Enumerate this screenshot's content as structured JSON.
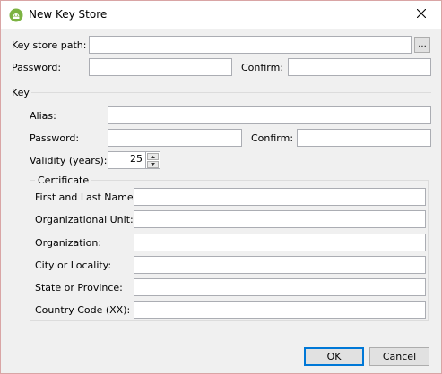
{
  "window": {
    "title": "New Key Store"
  },
  "store": {
    "path_label": "Key store path:",
    "path_value": "",
    "browse_label": "...",
    "password_label": "Password:",
    "password_value": "",
    "confirm_label": "Confirm:",
    "confirm_value": ""
  },
  "key": {
    "section_label": "Key",
    "alias_label": "Alias:",
    "alias_value": "",
    "password_label": "Password:",
    "password_value": "",
    "confirm_label": "Confirm:",
    "confirm_value": "",
    "validity_label": "Validity (years):",
    "validity_value": "25"
  },
  "certificate": {
    "legend": "Certificate",
    "fields": [
      {
        "label": "First and Last Name:",
        "value": ""
      },
      {
        "label": "Organizational Unit:",
        "value": ""
      },
      {
        "label": "Organization:",
        "value": ""
      },
      {
        "label": "City or Locality:",
        "value": ""
      },
      {
        "label": "State or Province:",
        "value": ""
      },
      {
        "label": "Country Code (XX):",
        "value": ""
      }
    ]
  },
  "buttons": {
    "ok_label": "OK",
    "cancel_label": "Cancel"
  },
  "colors": {
    "accent": "#0078d7",
    "android_icon": "#7cb342"
  }
}
